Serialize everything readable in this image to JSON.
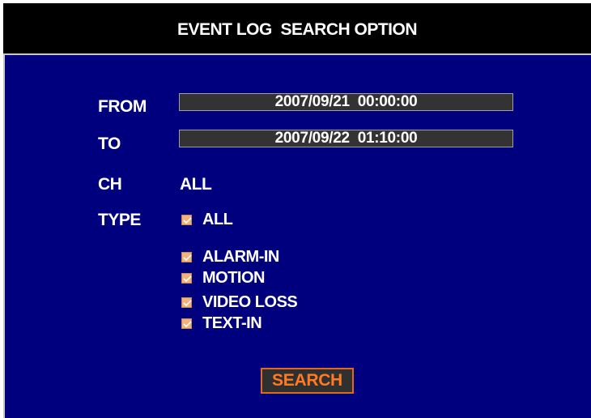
{
  "header": {
    "title": "EVENT LOG  SEARCH OPTION"
  },
  "form": {
    "from_label": "FROM",
    "from_value": "2007/09/21  00:00:00",
    "to_label": "TO",
    "to_value": "2007/09/22  01:10:00",
    "ch_label": "CH",
    "ch_value": "ALL",
    "type_label": "TYPE",
    "type_options": [
      {
        "label": "ALL",
        "checked": true
      },
      {
        "label": "ALARM-IN",
        "checked": true
      },
      {
        "label": "MOTION",
        "checked": true
      },
      {
        "label": "VIDEO LOSS",
        "checked": true
      },
      {
        "label": "TEXT-IN",
        "checked": true
      }
    ]
  },
  "actions": {
    "search_label": "SEARCH"
  },
  "colors": {
    "panel_background": "#00007f",
    "title_background": "#000000",
    "checkbox_fill": "#f2b27a",
    "search_accent": "#ff7a20"
  },
  "icons": {
    "checkbox": "checkmark-icon"
  }
}
